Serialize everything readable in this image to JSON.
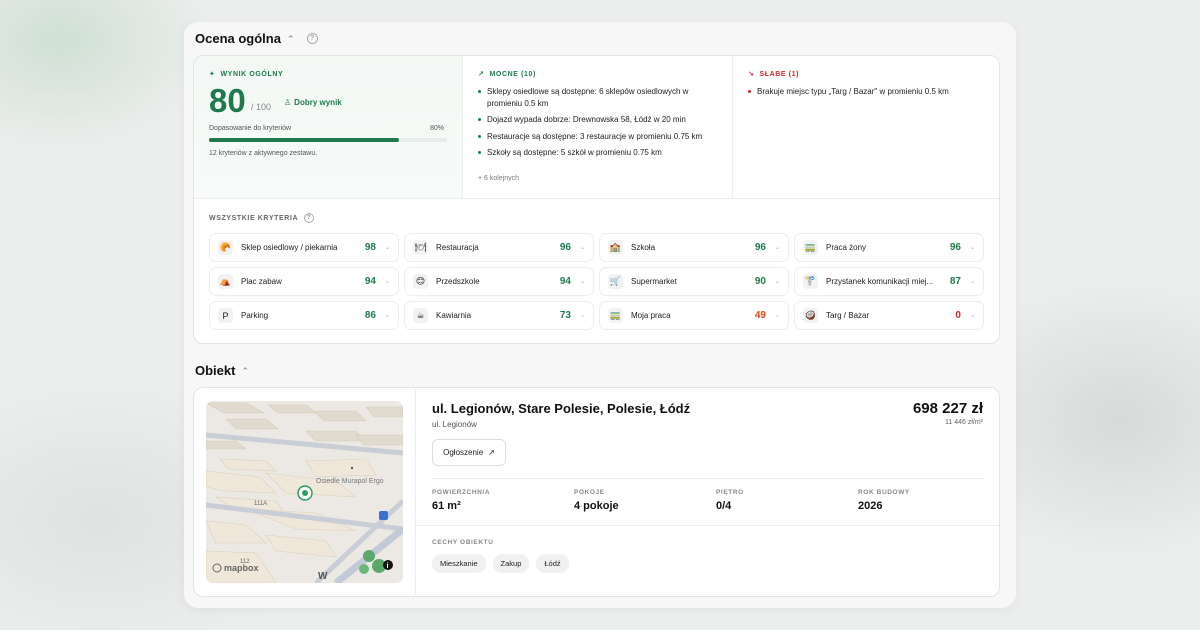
{
  "overall": {
    "title": "Ocena ogólna",
    "score_label": "WYNIK OGÓLNY",
    "score": "80",
    "score_of": "/ 100",
    "badge": "Dobry wynik",
    "fit_label": "Dopasowanie do kryteriów",
    "fit_percent": "80%",
    "fit_value": 0.8,
    "criteria_note": "12 kryteriów z aktywnego zestawu."
  },
  "strong": {
    "label": "MOCNE (10)",
    "items": [
      "Sklepy osiedlowe są dostępne: 6 sklepów osiedlowych w promieniu 0.5 km",
      "Dojazd wypada dobrze: Drewnowska 58, Łódź w 20 min",
      "Restauracje są dostępne: 3 restauracje w promieniu 0.75 km",
      "Szkoły są dostępne: 5 szkół w promieniu 0.75 km"
    ],
    "more": "+ 6 kolejnych"
  },
  "weak": {
    "label": "SŁABE (1)",
    "items": [
      "Brakuje miejsc typu „Targ / Bazar\" w promieniu 0.5 km"
    ]
  },
  "all_criteria": {
    "label": "WSZYSTKIE KRYTERIA",
    "items": [
      {
        "name": "Sklep osiedlowy / piekarnia",
        "score": "98",
        "icon": "🥐"
      },
      {
        "name": "Restauracja",
        "score": "96",
        "icon": "🍽"
      },
      {
        "name": "Szkoła",
        "score": "96",
        "icon": "🏫"
      },
      {
        "name": "Praca żony",
        "score": "96",
        "icon": "🚃"
      },
      {
        "name": "Plac zabaw",
        "score": "94",
        "icon": "⛺"
      },
      {
        "name": "Przedszkole",
        "score": "94",
        "icon": "😊"
      },
      {
        "name": "Supermarket",
        "score": "90",
        "icon": "🛒"
      },
      {
        "name": "Przystanek komunikacji miej...",
        "score": "87",
        "icon": "🚏"
      },
      {
        "name": "Parking",
        "score": "86",
        "icon": "P"
      },
      {
        "name": "Kawiarnia",
        "score": "73",
        "icon": "☕"
      },
      {
        "name": "Moja praca",
        "score": "49",
        "icon": "🚃"
      },
      {
        "name": "Targ / Bazar",
        "score": "0",
        "icon": "🥥"
      }
    ]
  },
  "object": {
    "title": "Obiekt",
    "address": "ul. Legionów, Stare Polesie, Polesie, Łódź",
    "street": "ul. Legionów",
    "listing_button": "Ogłoszenie",
    "price": "698 227 zł",
    "price_per_m2": "11 446 zł/m²",
    "facts": [
      {
        "label": "POWIERZCHNIA",
        "value": "61 m²"
      },
      {
        "label": "POKOJE",
        "value": "4 pokoje"
      },
      {
        "label": "PIĘTRO",
        "value": "0/4"
      },
      {
        "label": "ROK BUDOWY",
        "value": "2026"
      }
    ],
    "features_label": "CECHY OBIEKTU",
    "features": [
      "Mieszkanie",
      "Zakup",
      "Łódź"
    ]
  },
  "map": {
    "poi_label": "Osiedle Murapol Ergo",
    "building_numbers": [
      "111A",
      "112"
    ],
    "street_fragment": "W",
    "attribution": "mapbox"
  },
  "colors": {
    "good": "#1e7a4c",
    "medium": "#d9480f",
    "bad": "#c92a2a"
  }
}
